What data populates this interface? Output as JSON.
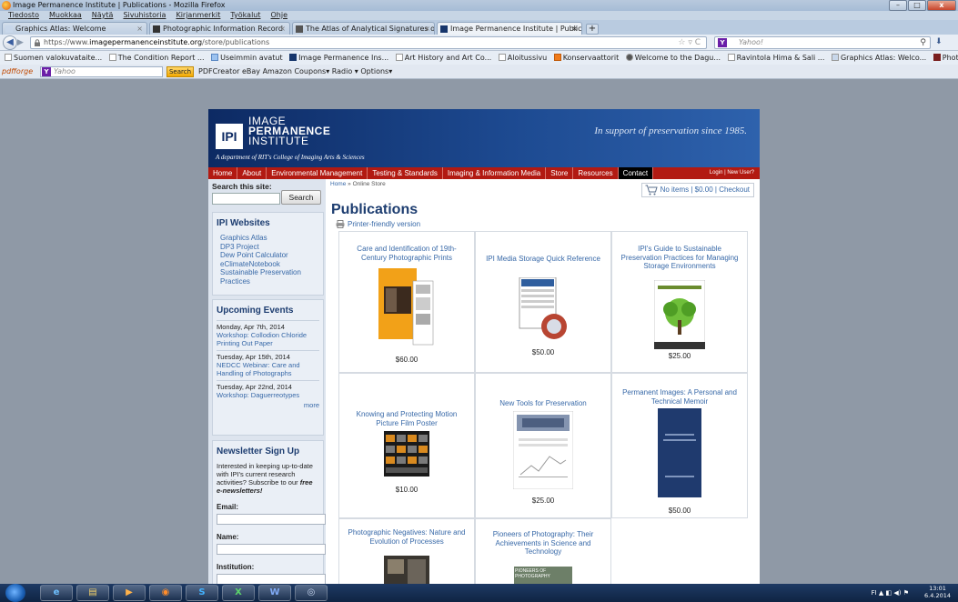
{
  "window": {
    "title": "Image Permanence Institute | Publications - Mozilla Firefox",
    "btn_min": "–",
    "btn_max": "□",
    "btn_close": "x"
  },
  "menu": [
    "Tiedosto",
    "Muokkaa",
    "Näytä",
    "Sivuhistoria",
    "Kirjanmerkit",
    "Työkalut",
    "Ohje"
  ],
  "tabs": [
    {
      "label": "Graphics Atlas: Welcome"
    },
    {
      "label": "Photographic Information Record"
    },
    {
      "label": "The Atlas of Analytical Signatures of ..."
    },
    {
      "label": "Image Permanence Institute | Publica..."
    }
  ],
  "navbar": {
    "url_prefix": "https://www.",
    "url_domain": "imagepermanenceinstitute.org",
    "url_path": "/store/publications",
    "search_placeholder": "Yahoo!",
    "back": "◀",
    "forward": "▶",
    "url_icons": "☆ ▿ C",
    "search_glyph": "⚲",
    "download_glyph": "⬇"
  },
  "bookmarks": [
    "Suomen valokuvataite...",
    "The Condition Report ...",
    "Useimmin avatut",
    "Image Permanence Ins...",
    "Art History and Art Co...",
    "Aloitussivu",
    "Konservaattorit",
    "Welcome to the Dagu...",
    "Ravintola Hima & Sali ...",
    "Graphics Atlas: Welco...",
    "Photograph Conservat..."
  ],
  "toolbar2": {
    "pdfforge": "pdfforge",
    "yahoo_placeholder": "Yahoo",
    "search_label": "Search",
    "items": "PDFCreator   eBay   Amazon   Coupons▾   Radio   ▾   Options▾"
  },
  "site": {
    "logo_abbr": "IPI",
    "logo_line1": "IMAGE",
    "logo_line2": "PERMANENCE",
    "logo_line3": "INSTITUTE",
    "dept": "A department of RIT's College of Imaging Arts & Sciences",
    "tagline": "In support of preservation since 1985.",
    "nav": [
      "Home",
      "About",
      "Environmental Management",
      "Testing & Standards",
      "Imaging & Information Media",
      "Store",
      "Resources",
      "Contact"
    ],
    "login": "Login | New User?"
  },
  "sidebar": {
    "search_label": "Search this site:",
    "search_button": "Search",
    "websites_title": "IPI Websites",
    "websites": [
      "Graphics Atlas",
      "DP3 Project",
      "Dew Point Calculator",
      "eClimateNotebook",
      "Sustainable Preservation",
      "Practices"
    ],
    "events_title": "Upcoming Events",
    "events": [
      {
        "date": "Monday, Apr 7th, 2014",
        "title": "Workshop: Collodion Chloride Printing Out Paper"
      },
      {
        "date": "Tuesday, Apr 15th, 2014",
        "title": "NEDCC Webinar: Care and Handling of Photographs"
      },
      {
        "date": "Tuesday, Apr 22nd, 2014",
        "title": "Workshop: Daguerreotypes"
      }
    ],
    "events_more": "more",
    "newsletter_title": "Newsletter Sign Up",
    "newsletter_text": "Interested in keeping up-to-date with IPI's current research activities? Subscribe to our",
    "newsletter_emph": "free e-newsletters!",
    "email_label": "Email:",
    "name_label": "Name:",
    "institution_label": "Institution:"
  },
  "content": {
    "breadcrumb_home": "Home",
    "breadcrumb_sep": " » ",
    "breadcrumb_current": "Online Store",
    "cart": "No items | $0.00 | Checkout",
    "title": "Publications",
    "printer": "Printer-friendly version",
    "products": [
      {
        "name": "Care and Identification of 19th-Century Photographic Prints",
        "price": "$60.00"
      },
      {
        "name": "IPI Media Storage Quick Reference",
        "price": "$50.00"
      },
      {
        "name": "IPI's Guide to Sustainable Preservation Practices for Managing Storage Environments",
        "price": "$25.00"
      },
      {
        "name": "Knowing and Protecting Motion Picture Film Poster",
        "price": "$10.00"
      },
      {
        "name": "New Tools for Preservation",
        "price": "$25.00"
      },
      {
        "name": "Permanent Images: A Personal and Technical Memoir",
        "price": "$50.00"
      },
      {
        "name": "Photographic Negatives: Nature and Evolution of Processes",
        "price": ""
      },
      {
        "name": "Pioneers of Photography: Their Achievements in Science and Technology",
        "price": ""
      }
    ],
    "pioneers_cover_text": "PIONEERS OF PHOTOGRAPHY"
  },
  "taskbar": {
    "apps": [
      "e",
      "▤",
      "▶",
      "◉",
      "S",
      "X",
      "W",
      "◎"
    ],
    "tray": "FI  ▲  ◧  ◀)  ⚑",
    "time": "13:01",
    "date": "6.4.2014"
  }
}
